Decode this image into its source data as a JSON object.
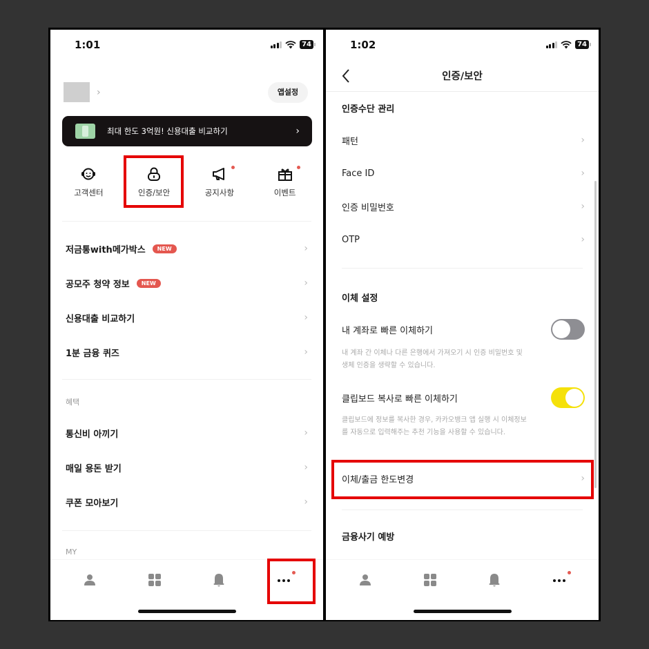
{
  "left_screen": {
    "status_bar": {
      "time": "1:01",
      "battery": "74"
    },
    "profile": {
      "chevron": "›"
    },
    "app_settings_label": "앱설정",
    "banner": {
      "text": "최대 한도 3억원! 신용대출 비교하기",
      "arrow": "›",
      "icon": "money-icon"
    },
    "quick_menu": [
      {
        "label": "고객센터",
        "icon": "headset-icon",
        "badge": false
      },
      {
        "label": "인증/보안",
        "icon": "lock-icon",
        "badge": false,
        "highlighted": true
      },
      {
        "label": "공지사항",
        "icon": "megaphone-icon",
        "badge": true
      },
      {
        "label": "이벤트",
        "icon": "gift-icon",
        "badge": true
      }
    ],
    "menu_items": [
      {
        "label": "저금통with메가박스",
        "badge": "NEW"
      },
      {
        "label": "공모주 청약 정보",
        "badge": "NEW"
      },
      {
        "label": "신용대출 비교하기"
      },
      {
        "label": "1분 금융 퀴즈"
      }
    ],
    "benefits_section": {
      "label": "혜택",
      "items": [
        {
          "label": "통신비 아끼기"
        },
        {
          "label": "매일 용돈 받기"
        },
        {
          "label": "쿠폰 모아보기"
        }
      ]
    },
    "my_section_label": "MY",
    "tab_bar": [
      {
        "icon": "person-icon",
        "name": "profile"
      },
      {
        "icon": "grid-icon",
        "name": "products"
      },
      {
        "icon": "bell-icon",
        "name": "notifications"
      },
      {
        "icon": "more-icon",
        "name": "more",
        "badge": true,
        "highlighted": true
      }
    ],
    "chevron": "›"
  },
  "right_screen": {
    "status_bar": {
      "time": "1:02",
      "battery": "74"
    },
    "nav": {
      "title": "인증/보안",
      "back_icon": "back-icon"
    },
    "auth_section": {
      "title": "인증수단 관리",
      "items": [
        {
          "label": "패턴"
        },
        {
          "label": "Face ID"
        },
        {
          "label": "인증 비밀번호"
        },
        {
          "label": "OTP"
        }
      ]
    },
    "transfer_section": {
      "title": "이체 설정",
      "quick_transfer": {
        "label": "내 계좌로 빠른 이체하기",
        "enabled": false,
        "description": "내 계좌 간 이체나 다른 은행에서 가져오기 시 인증 비밀번호 및 생체 인증을 생략할 수 있습니다."
      },
      "clipboard_transfer": {
        "label": "클립보드 복사로 빠른 이체하기",
        "enabled": true,
        "description": "클립보드에 정보를 복사한 경우, 카카오뱅크 앱 실행 시 이체정보를 자동으로 입력해주는 추천 기능을 사용할 수 있습니다."
      },
      "limit_change": {
        "label": "이체/출금 한도변경",
        "highlighted": true
      }
    },
    "fraud_section": {
      "title": "금융사기 예방"
    },
    "colors": {
      "toggle_on": "#f5e10a",
      "toggle_off": "#8e8e93",
      "highlight_box": "#e50000",
      "new_badge": "#e4574f"
    },
    "chevron": "›"
  }
}
